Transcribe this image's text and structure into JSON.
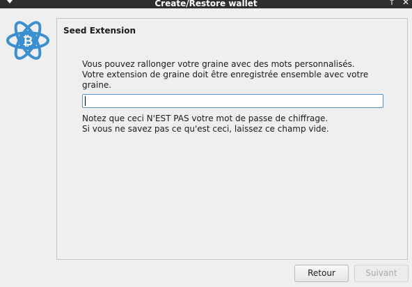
{
  "window": {
    "title": "Create/Restore wallet",
    "titlebar_color": "#2f2f2f"
  },
  "logo": {
    "icon": "electrum-bitcoin-logo",
    "color": "#3a8fd0"
  },
  "panel": {
    "heading": "Seed Extension",
    "message_lines": [
      "Vous pouvez rallonger votre graine avec des mots personnalisés.",
      "Votre extension de graine doit être enregistrée ensemble avec votre",
      "graine."
    ],
    "input_value": "",
    "note_lines": [
      "Notez que ceci N'EST PAS votre mot de passe de chiffrage.",
      "Si vous ne savez pas ce qu'est ceci, laissez ce champ vide."
    ]
  },
  "buttons": {
    "back_label": "Retour",
    "next_label": "Suivant",
    "next_enabled": false
  }
}
